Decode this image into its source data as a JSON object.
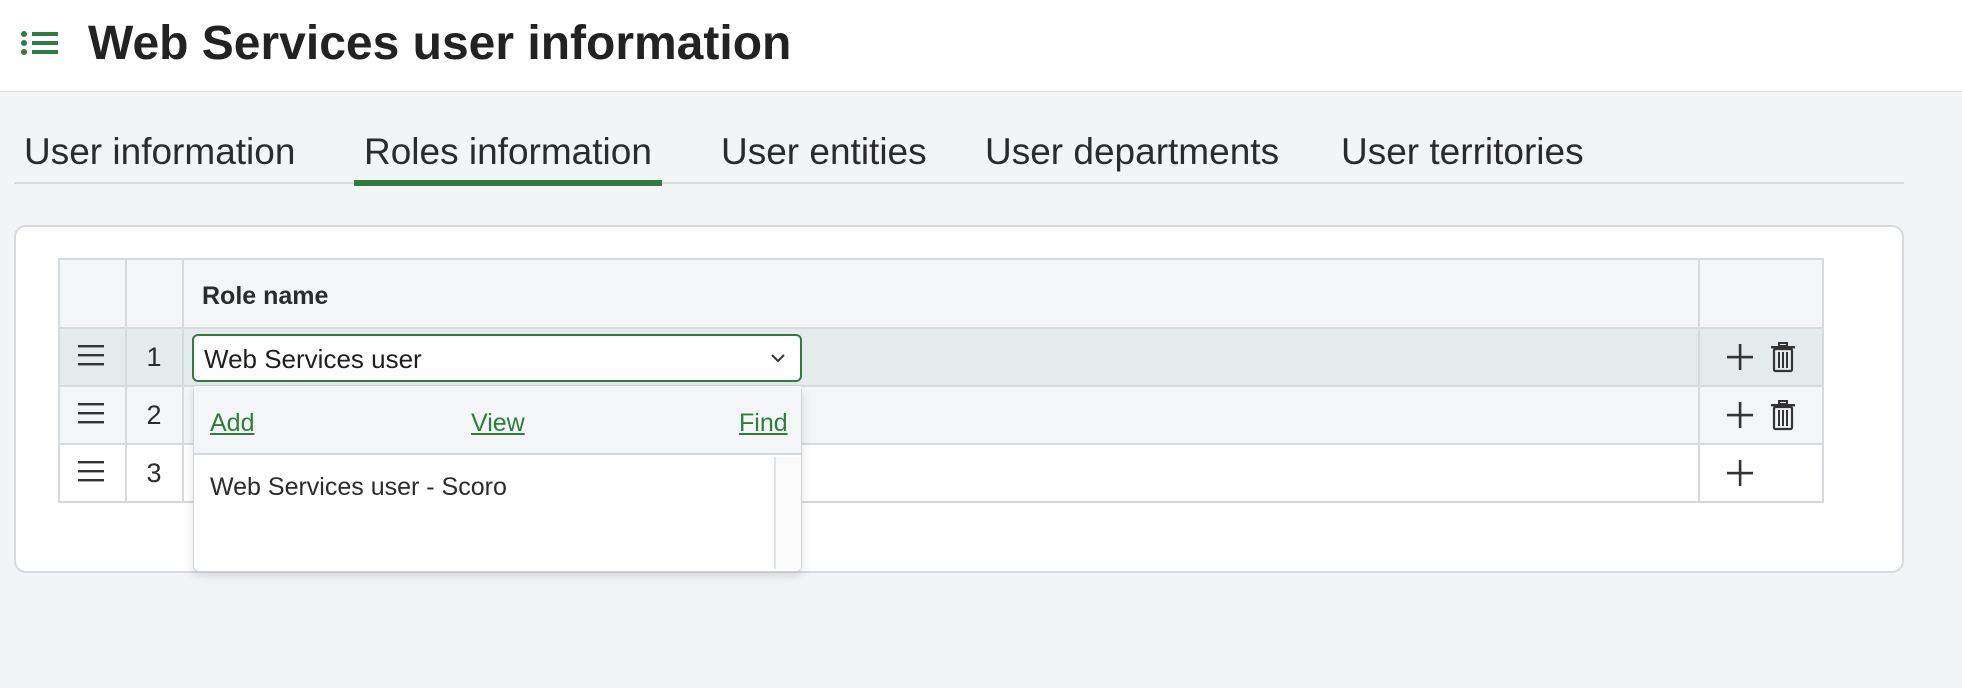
{
  "header": {
    "title": "Web Services user information",
    "menu_icon": "list-icon",
    "accent_color": "#2e7d3f"
  },
  "tabs": [
    {
      "label": "User information",
      "active": false
    },
    {
      "label": "Roles information",
      "active": true
    },
    {
      "label": "User entities",
      "active": false
    },
    {
      "label": "User departments",
      "active": false
    },
    {
      "label": "User territories",
      "active": false
    }
  ],
  "table": {
    "column_header": "Role name",
    "rows": [
      {
        "number": "1",
        "role": "Web Services user",
        "actions": [
          "add-icon",
          "trash-icon"
        ]
      },
      {
        "number": "2",
        "role": "",
        "actions": [
          "add-icon",
          "trash-icon"
        ]
      },
      {
        "number": "3",
        "role": "",
        "actions": [
          "add-icon"
        ]
      }
    ]
  },
  "dropdown": {
    "add_label": "Add",
    "view_label": "View",
    "find_label": "Find",
    "options": [
      "Web Services user - Scoro"
    ]
  }
}
